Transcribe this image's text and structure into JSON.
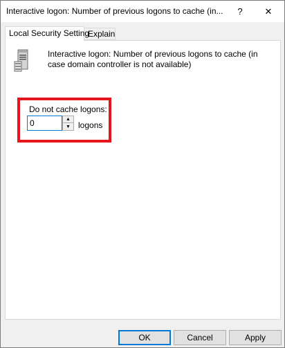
{
  "window": {
    "title": "Interactive logon: Number of previous logons to cache (in...",
    "help_glyph": "?",
    "close_glyph": "✕"
  },
  "tabs": [
    {
      "label": "Local Security Setting",
      "active": true
    },
    {
      "label": "Explain",
      "active": false
    }
  ],
  "policy": {
    "icon": "server-icon",
    "description": "Interactive logon: Number of previous logons to cache (in case domain controller is not available)"
  },
  "setting": {
    "label": "Do not cache logons:",
    "value": "0",
    "unit": "logons",
    "spin_up_glyph": "▲",
    "spin_down_glyph": "▼"
  },
  "annotation": {
    "highlight_color": "#e8141c"
  },
  "buttons": {
    "ok": "OK",
    "cancel": "Cancel",
    "apply": "Apply"
  },
  "colors": {
    "accent": "#0078d7"
  }
}
